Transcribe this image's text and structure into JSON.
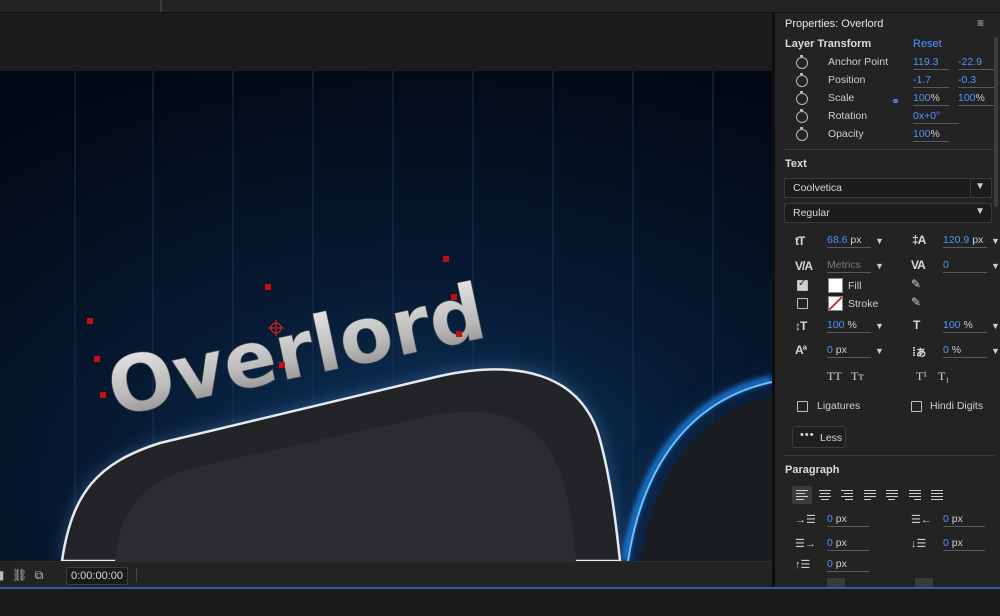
{
  "properties": {
    "title": "Properties: Overlord",
    "menu_icon": "hamburger-icon",
    "layer_transform": {
      "heading": "Layer Transform",
      "reset_label": "Reset",
      "anchor_point": {
        "label": "Anchor Point",
        "x": "119.3",
        "y": "-22.9"
      },
      "position": {
        "label": "Position",
        "x": "-1.7",
        "y": "-0.3"
      },
      "scale": {
        "label": "Scale",
        "x": "100",
        "y": "100",
        "unit": "%"
      },
      "rotation": {
        "label": "Rotation",
        "value": "0x+0°"
      },
      "opacity": {
        "label": "Opacity",
        "value": "100",
        "unit": "%"
      }
    },
    "text": {
      "heading": "Text",
      "font_family": "Coolvetica",
      "font_style": "Regular",
      "font_size": "68.6",
      "font_size_unit": "px",
      "leading": "120.9",
      "leading_unit": "px",
      "kerning": "Metrics",
      "tracking": "0",
      "fill_label": "Fill",
      "fill_checked": true,
      "fill_color": "#ffffff",
      "stroke_label": "Stroke",
      "stroke_checked": false,
      "vertical_scale": "100",
      "vertical_scale_unit": "%",
      "horizontal_scale": "100",
      "horizontal_scale_unit": "%",
      "baseline_shift": "0",
      "baseline_shift_unit": "px",
      "tsume": "0",
      "tsume_unit": "%",
      "all_caps": "TT",
      "small_caps": "Tт",
      "superscript": "T¹",
      "subscript": "T₁",
      "ligatures_label": "Ligatures",
      "hindi_digits_label": "Hindi Digits",
      "less_label": "Less"
    },
    "paragraph": {
      "heading": "Paragraph",
      "indent_left": "0",
      "indent_right": "0",
      "indent_first": "0",
      "space_before": "0",
      "space_after": "0",
      "indent_last": "0",
      "unit": "px"
    }
  },
  "viewer": {
    "text_layer": "Overlord",
    "timecode": "0:00:00:00"
  },
  "colors": {
    "accent": "#4d95ff",
    "panel_bg": "#232323",
    "glow": "#1e8fff"
  }
}
